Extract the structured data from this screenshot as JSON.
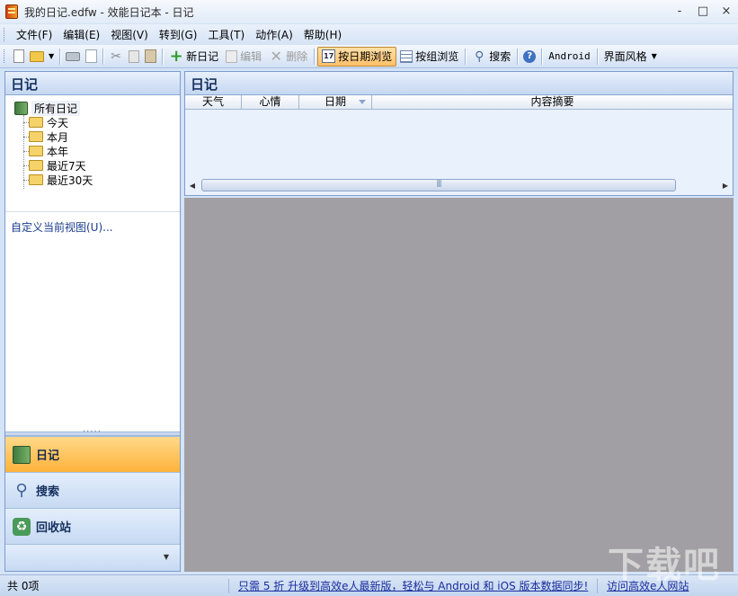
{
  "window": {
    "title": "我的日记.edfw - 效能日记本 - 日记",
    "controls": [
      "-",
      "□",
      "×"
    ]
  },
  "menu": [
    "文件(F)",
    "编辑(E)",
    "视图(V)",
    "转到(G)",
    "工具(T)",
    "动作(A)",
    "帮助(H)"
  ],
  "toolbar": {
    "new_entry": "新日记",
    "edit": "编辑",
    "delete": "删除",
    "by_date": "按日期浏览",
    "by_group": "按组浏览",
    "search": "搜索",
    "android": "Android",
    "skin": "界面风格",
    "calendar_glyph": "17"
  },
  "left_panel": {
    "header": "日记",
    "tree_root": "所有日记",
    "tree_items": [
      "今天",
      "本月",
      "本年",
      "最近7天",
      "最近30天"
    ],
    "custom_view_link": "自定义当前视图(U)...",
    "nav_buttons": [
      "日记",
      "搜索",
      "回收站"
    ]
  },
  "right_panel": {
    "header": "日记",
    "columns": [
      "天气",
      "心情",
      "日期",
      "内容摘要"
    ]
  },
  "status": {
    "count": "共 0项",
    "promo": "只需 5 折 升级到高效e人最新版，轻松与 Android 和 iOS 版本数据同步!",
    "site_link": "访问高效e人网站"
  },
  "watermark": "下载吧",
  "colors": {
    "accent_active": "#ffb33a",
    "panel_header_text": "#15305e",
    "content_gray": "#a19fa3",
    "link_blue": "#1a2c9c"
  }
}
